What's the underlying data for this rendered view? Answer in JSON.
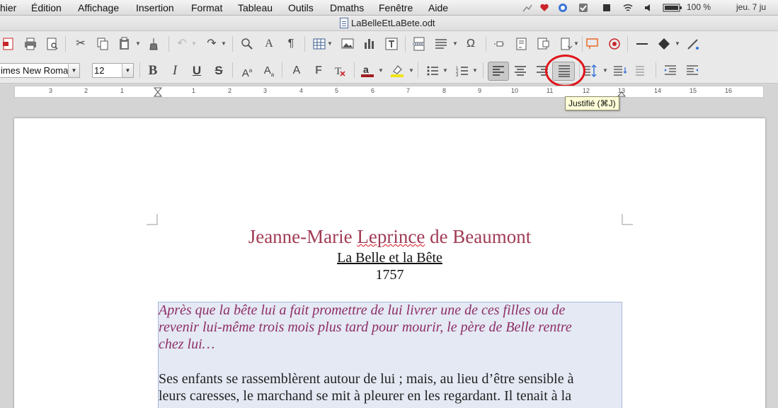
{
  "menubar": {
    "items": [
      "hier",
      "Édition",
      "Affichage",
      "Insertion",
      "Format",
      "Tableau",
      "Outils",
      "Dmaths",
      "Fenêtre",
      "Aide"
    ],
    "battery": "100 %",
    "clock": "jeu. 7 ju"
  },
  "window": {
    "title": "LaBelleEtLaBete.odt"
  },
  "toolbar2": {
    "font_name": "imes New Roma",
    "font_size": "12"
  },
  "ruler": {
    "labels": [
      "3",
      "2",
      "1",
      "1",
      "2",
      "3",
      "4",
      "5",
      "6",
      "7",
      "8",
      "9",
      "10",
      "11",
      "12",
      "13",
      "14",
      "15",
      "16"
    ]
  },
  "tooltip": {
    "text": "Justifié (⌘J)"
  },
  "document": {
    "author_pre": "Jeanne-Marie ",
    "author_squiggle": "Leprince",
    "author_post": " de Beaumont",
    "book_title": "La Belle et la Bête",
    "year": "1757",
    "intro_lines": [
      "Après que la bête lui a fait promettre de lui livrer une de ces filles ou de",
      "revenir lui-même trois mois plus tard pour mourir, le père de Belle rentre",
      "chez lui…"
    ],
    "body_lines": [
      "Ses enfants se rassemblèrent autour de lui ; mais, au lieu d’être sensible à",
      "leurs caresses, le marchand se mit à pleurer en les regardant. Il tenait à la"
    ]
  },
  "colors": {
    "author": "#a13c55",
    "intro": "#8e2e66",
    "highlight_circle": "#e0141a"
  }
}
